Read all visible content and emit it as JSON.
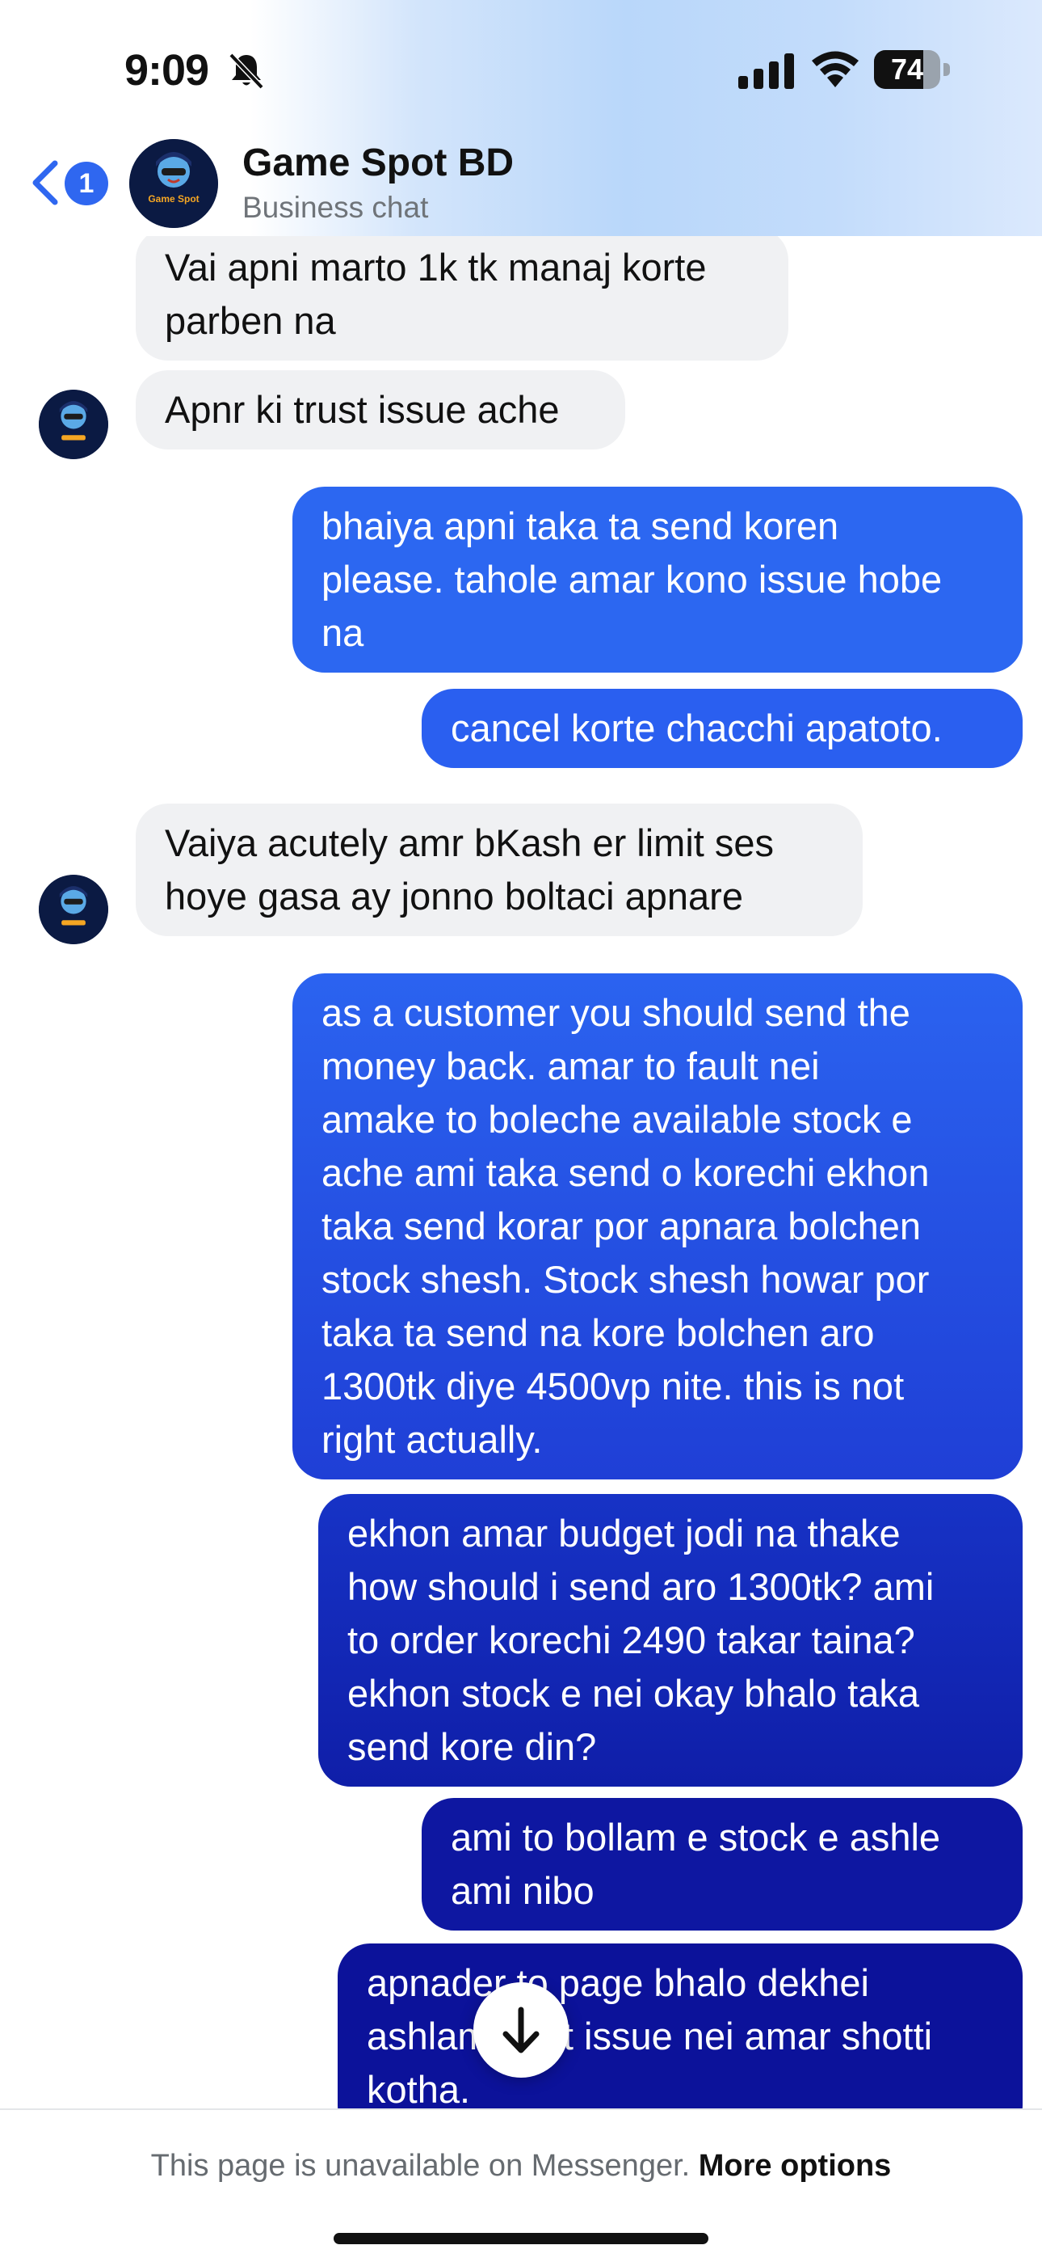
{
  "status_bar": {
    "time": "9:09",
    "battery_level": "74",
    "battery_fraction": 0.74
  },
  "header": {
    "back_badge_count": "1",
    "contact_name": "Game Spot BD",
    "contact_subtitle": "Business chat",
    "avatar_text": "Game Spot"
  },
  "messages": [
    {
      "direction": "incoming",
      "text": "Vai apni marto 1k tk manaj korte\nparben na"
    },
    {
      "direction": "incoming",
      "text": "Apnr ki trust issue ache"
    },
    {
      "direction": "outgoing",
      "text": "bhaiya apni taka ta send koren\nplease. tahole amar kono issue hobe\nna"
    },
    {
      "direction": "outgoing",
      "text": "cancel korte chacchi apatoto."
    },
    {
      "direction": "incoming",
      "text": "Vaiya acutely amr bKash er limit ses\nhoye gasa ay jonno boltaci apnare"
    },
    {
      "direction": "outgoing",
      "text": "as a customer you should send the\nmoney back. amar to fault nei\namake to boleche available stock e\nache ami taka send o korechi ekhon\ntaka send korar por apnara bolchen\nstock shesh. Stock shesh howar por\ntaka ta send na kore bolchen aro\n1300tk diye 4500vp nite. this is not\nright actually."
    },
    {
      "direction": "outgoing",
      "text": "ekhon amar budget jodi na thake\nhow should i send aro 1300tk? ami\nto order korechi 2490 takar taina?\nekhon stock e nei okay bhalo taka\nsend kore din?"
    },
    {
      "direction": "outgoing",
      "text": "ami to bollam e stock e ashle\nami nibo"
    },
    {
      "direction": "outgoing",
      "text": "apnader to page bhalo dekhei\nashlam trust issue nei amar shotti\nkotha."
    }
  ],
  "footer": {
    "notice": "This page is unavailable on Messenger.",
    "link": "More options"
  },
  "colors": {
    "accent": "#2f67f0",
    "bubble_incoming": "#f0f1f3",
    "bubble_outgoing_light": "#2d67f0",
    "bubble_outgoing_dark": "#0d139c"
  },
  "icons": [
    "bell-slash-icon",
    "cellular-signal-icon",
    "wifi-icon",
    "battery-icon",
    "back-chevron-icon",
    "arrow-down-icon"
  ]
}
